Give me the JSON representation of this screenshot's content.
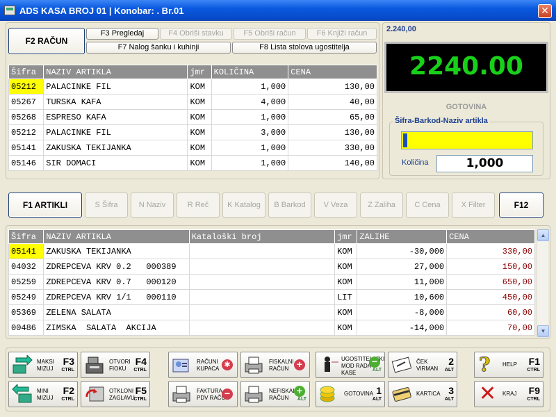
{
  "window": {
    "title": "ADS KASA BROJ 01 | Konobar: . Br.01",
    "close": "✕"
  },
  "top_buttons": {
    "racun": "F2    RAČUN",
    "f3": "F3    Pregledaj",
    "f4": "F4    Obriši stavku",
    "f5": "F5    Obriši račun",
    "f6": "F6    Knjiži račun",
    "f7": "F7    Nalog šanku i kuhinji",
    "f8": "F8    Lista stolova ugostitelja"
  },
  "display": {
    "small_total": "2.240,00",
    "total": "2240.00",
    "payment": "GOTOVINA"
  },
  "search": {
    "legend": "Šifra-Barkod-Naziv artikla",
    "qty_label": "Količina",
    "qty_value": "1,000"
  },
  "receipt": {
    "headers": [
      "Šifra",
      "NAZIV ARTIKLA",
      "jmr",
      "KOLIČINA",
      "CENA"
    ],
    "rows": [
      [
        "05212",
        "PALACINKE FIL",
        "KOM",
        "1,000",
        "130,00"
      ],
      [
        "05267",
        "TURSKA KAFA",
        "KOM",
        "4,000",
        "40,00"
      ],
      [
        "05268",
        "ESPRESO KAFA",
        "KOM",
        "1,000",
        "65,00"
      ],
      [
        "05212",
        "PALACINKE FIL",
        "KOM",
        "3,000",
        "130,00"
      ],
      [
        "05141",
        "ZAKUSKA TEKIJANKA",
        "KOM",
        "1,000",
        "330,00"
      ],
      [
        "05146",
        "SIR DOMACI",
        "KOM",
        "1,000",
        "140,00"
      ]
    ]
  },
  "filters": {
    "artikli": "F1    ARTIKLI",
    "sifra": "S  Šifra",
    "naziv": "N  Naziv",
    "rec": "R  Reč",
    "katalog": "K  Katalog",
    "barkod": "B  Barkod",
    "veza": "V  Veza",
    "zaliha": "Z  Zaliha",
    "cena": "C  Cena",
    "filter": "X  Filter",
    "f12": "F12"
  },
  "articles": {
    "headers": [
      "Šifra",
      "NAZIV ARTIKLA",
      "Kataloški broj",
      "jmr",
      "ZALIHE",
      "CENA"
    ],
    "rows": [
      [
        "05141",
        "ZAKUSKA TEKIJANKA",
        "",
        "KOM",
        "-30,000",
        "330,00"
      ],
      [
        "04032",
        "ZDREPCEVA KRV 0.2   000389",
        "",
        "KOM",
        "27,000",
        "150,00"
      ],
      [
        "05259",
        "ZDREPCEVA KRV 0.7   000120",
        "",
        "KOM",
        "11,000",
        "650,00"
      ],
      [
        "05249",
        "ZDREPCEVA KRV 1/1   000110",
        "",
        "LIT",
        "10,600",
        "450,00"
      ],
      [
        "05369",
        "ZELENA SALATA",
        "",
        "KOM",
        "-8,000",
        "60,00"
      ],
      [
        "00486",
        "ZIMSKA  SALATA  AKCIJA",
        "",
        "KOM",
        "-14,000",
        "70,00"
      ]
    ]
  },
  "tiles": {
    "maksi": {
      "label": "MAKSI\nMIZUJ",
      "key": "F3",
      "mod": "CTRL"
    },
    "mini": {
      "label": "MINI\nMIZUJ",
      "key": "F2",
      "mod": "CTRL"
    },
    "otvori": {
      "label": "OTVORI\nFIOKU",
      "key": "F4",
      "mod": "CTRL"
    },
    "otkloni": {
      "label": "OTKLONI\nZAGLAVU",
      "key": "F5",
      "mod": "CTRL"
    },
    "racuni": {
      "label": "RAČUNI\nKUPACA"
    },
    "faktura": {
      "label": "FAKTURA\nPDV RAČUN"
    },
    "fiskalni": {
      "label": "FISKALNI\nRAČUN"
    },
    "nefiskalni": {
      "label": "NEFISKALNI\nRAČUN",
      "mod": "ALT"
    },
    "ugost": {
      "label": "UGOSTITELJSKI\nMOD RADA\nKASE",
      "mod": "ALT"
    },
    "gotovina": {
      "label": "GOTOVINA",
      "key": "1",
      "mod": "ALT"
    },
    "cek": {
      "label": "ČEK\nVIRMAN",
      "key": "2",
      "mod": "ALT"
    },
    "kartica": {
      "label": "KARTICA",
      "key": "3",
      "mod": "ALT"
    },
    "help": {
      "label": "HELP",
      "key": "F1",
      "mod": "CTRL"
    },
    "kraj": {
      "label": "KRAJ",
      "key": "F9",
      "mod": "CTRL"
    }
  },
  "colors": {
    "accent": "#0a5ae0",
    "display_text": "#19d019",
    "selection": "#ffff00"
  }
}
